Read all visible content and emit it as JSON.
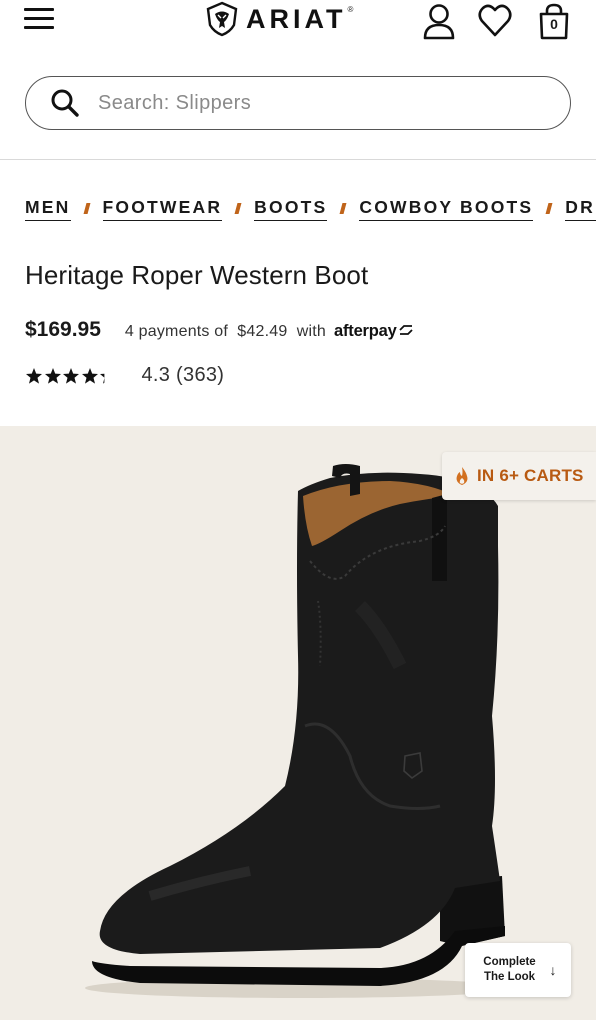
{
  "header": {
    "brand": "ARIAT",
    "brand_reg": "®",
    "bag_count": "0"
  },
  "search": {
    "placeholder": "Search: Slippers"
  },
  "breadcrumb": [
    "MEN",
    "FOOTWEAR",
    "BOOTS",
    "COWBOY BOOTS",
    "DRES"
  ],
  "product": {
    "title": "Heritage Roper Western Boot",
    "price": "$169.95",
    "afterpay_text": "4 payments of  $42.49  with",
    "afterpay_brand": "afterpay",
    "rating": 4.3,
    "rating_text": "4.3 (363)"
  },
  "badge": {
    "carts_text": "IN 6+ CARTS"
  },
  "complete_look": {
    "label": "Complete The Look",
    "arrow": "↓"
  },
  "colors": {
    "accent": "#c0641a",
    "badge_text": "#b85a12",
    "hero_bg": "#f1ede6"
  },
  "icons": {
    "menu": "hamburger-icon",
    "account": "user-icon",
    "wishlist": "heart-icon",
    "bag": "shopping-bag-icon",
    "search": "search-icon",
    "flame": "flame-icon"
  }
}
